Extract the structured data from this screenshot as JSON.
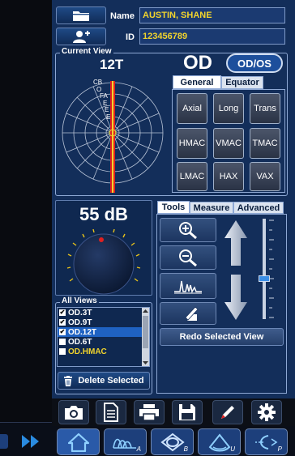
{
  "patient": {
    "name_label": "Name",
    "name_value": "AUSTIN, SHANE",
    "id_label": "ID",
    "id_value": "123456789"
  },
  "current_view": {
    "legend": "Current View",
    "view_label": "12T",
    "eye": "OD",
    "eye_toggle": "OD/OS",
    "chart_labels": [
      "CB",
      "O",
      "FA",
      "E",
      "E",
      "E"
    ],
    "tabs": [
      "General",
      "Equator"
    ],
    "active_tab": "General",
    "view_buttons": [
      "Axial",
      "Long",
      "Trans",
      "HMAC",
      "VMAC",
      "TMAC",
      "LMAC",
      "HAX",
      "VAX"
    ]
  },
  "gain": {
    "value": "55 dB"
  },
  "tools": {
    "tabs": [
      "Tools",
      "Measure",
      "Advanced"
    ],
    "active_tab": "Tools",
    "slider_fraction": 0.6,
    "redo_label": "Redo Selected View"
  },
  "all_views": {
    "legend": "All Views",
    "items": [
      {
        "label": "OD.3T",
        "checked": true,
        "selected": false
      },
      {
        "label": "OD.9T",
        "checked": true,
        "selected": false
      },
      {
        "label": "OD.12T",
        "checked": true,
        "selected": true
      },
      {
        "label": "OD.6T",
        "checked": false,
        "selected": false
      },
      {
        "label": "OD.HMAC",
        "checked": false,
        "selected": false
      }
    ],
    "delete_label": "Delete Selected"
  },
  "bottom_nav": {
    "subs": [
      "A",
      "B",
      "U",
      "P"
    ]
  },
  "colors": {
    "panel": "#132e5a",
    "field_text": "#f2d42c",
    "accent_red": "#e02020",
    "selection": "#1f62c2"
  }
}
